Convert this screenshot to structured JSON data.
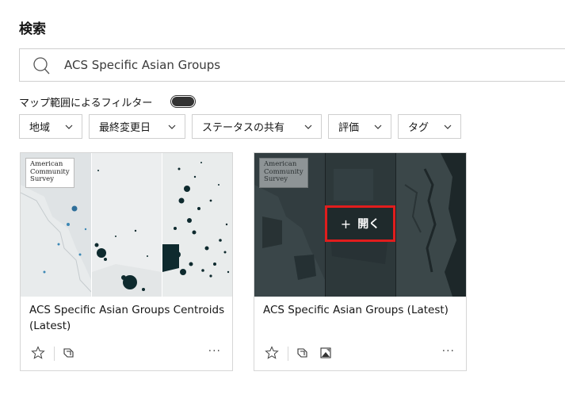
{
  "page": {
    "title": "検索"
  },
  "search": {
    "value": "ACS Specific Asian Groups",
    "placeholder": ""
  },
  "map_filter": {
    "label": "マップ範囲によるフィルター",
    "enabled": false
  },
  "filters": [
    {
      "label": "地域"
    },
    {
      "label": "最終変更日"
    },
    {
      "label": "ステータスの共有"
    },
    {
      "label": "評価"
    },
    {
      "label": "タグ"
    }
  ],
  "cards": [
    {
      "title": "ACS Specific Asian Groups Centroids (Latest)",
      "logo": "American\nCommunity\nSurvey",
      "type_icons": [
        "feature-layer-icon"
      ],
      "more": "···"
    },
    {
      "title": "ACS Specific Asian Groups (Latest)",
      "logo": "American\nCommunity\nSurvey",
      "type_icons": [
        "feature-layer-icon",
        "map-image-icon"
      ],
      "open_label": "開く",
      "open_plus": "+",
      "more": "···"
    }
  ]
}
